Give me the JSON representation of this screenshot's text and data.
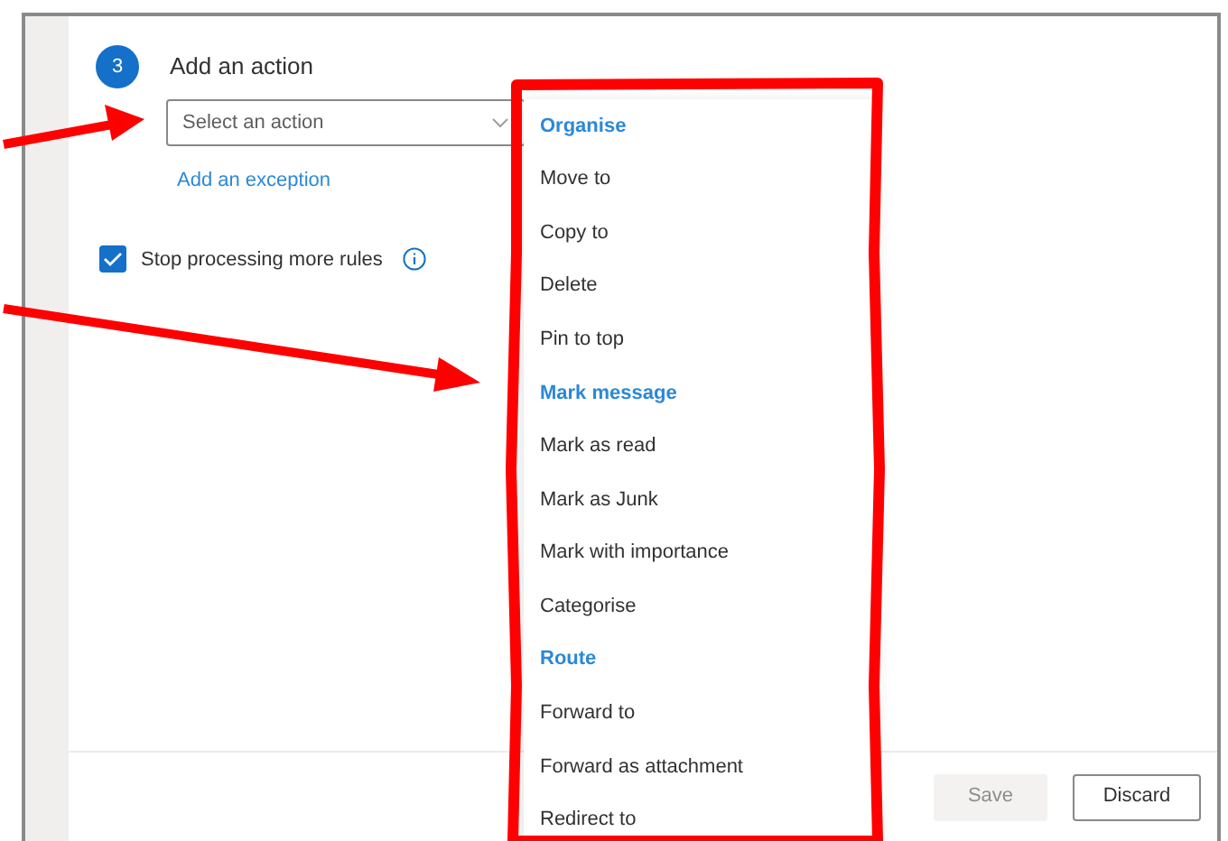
{
  "step": {
    "number": "3",
    "title": "Add an action"
  },
  "action_select": {
    "placeholder": "Select an action"
  },
  "exception_link": "Add an exception",
  "stop_processing": {
    "label": "Stop processing more rules",
    "checked": true
  },
  "action_menu": [
    {
      "kind": "header",
      "label": "Organise"
    },
    {
      "kind": "option",
      "label": "Move to"
    },
    {
      "kind": "option",
      "label": "Copy to"
    },
    {
      "kind": "option",
      "label": "Delete"
    },
    {
      "kind": "option",
      "label": "Pin to top"
    },
    {
      "kind": "header",
      "label": "Mark message"
    },
    {
      "kind": "option",
      "label": "Mark as read"
    },
    {
      "kind": "option",
      "label": "Mark as Junk"
    },
    {
      "kind": "option",
      "label": "Mark with importance"
    },
    {
      "kind": "option",
      "label": "Categorise"
    },
    {
      "kind": "header",
      "label": "Route"
    },
    {
      "kind": "option",
      "label": "Forward to"
    },
    {
      "kind": "option",
      "label": "Forward as attachment"
    },
    {
      "kind": "option",
      "label": "Redirect to"
    }
  ],
  "buttons": [
    {
      "label": "Save",
      "disabled": true
    },
    {
      "label": "Discard",
      "disabled": false
    }
  ]
}
